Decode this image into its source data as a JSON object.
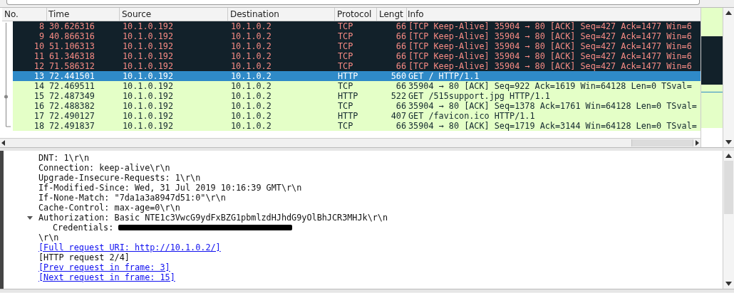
{
  "packet_list": {
    "columns": [
      "No.",
      "Time",
      "Source",
      "Destination",
      "Protocol",
      "Lengt",
      "Info"
    ],
    "rows": [
      {
        "no": "8",
        "time": "30.626316",
        "source": "10.1.0.192",
        "destination": "10.1.0.2",
        "protocol": "TCP",
        "length": "66",
        "info": "[TCP Keep-Alive] 35904 → 80 [ACK] Seq=427 Ack=1477 Win=6",
        "kind": "bad",
        "selected": false
      },
      {
        "no": "9",
        "time": "40.866316",
        "source": "10.1.0.192",
        "destination": "10.1.0.2",
        "protocol": "TCP",
        "length": "66",
        "info": "[TCP Keep-Alive] 35904 → 80 [ACK] Seq=427 Ack=1477 Win=6",
        "kind": "bad",
        "selected": false
      },
      {
        "no": "10",
        "time": "51.106313",
        "source": "10.1.0.192",
        "destination": "10.1.0.2",
        "protocol": "TCP",
        "length": "66",
        "info": "[TCP Keep-Alive] 35904 → 80 [ACK] Seq=427 Ack=1477 Win=6",
        "kind": "bad",
        "selected": false
      },
      {
        "no": "11",
        "time": "61.346318",
        "source": "10.1.0.192",
        "destination": "10.1.0.2",
        "protocol": "TCP",
        "length": "66",
        "info": "[TCP Keep-Alive] 35904 → 80 [ACK] Seq=427 Ack=1477 Win=6",
        "kind": "bad",
        "selected": false
      },
      {
        "no": "12",
        "time": "71.586312",
        "source": "10.1.0.192",
        "destination": "10.1.0.2",
        "protocol": "TCP",
        "length": "66",
        "info": "[TCP Keep-Alive] 35904 → 80 [ACK] Seq=427 Ack=1477 Win=6",
        "kind": "bad",
        "selected": false
      },
      {
        "no": "13",
        "time": "72.441501",
        "source": "10.1.0.192",
        "destination": "10.1.0.2",
        "protocol": "HTTP",
        "length": "560",
        "info": "GET / HTTP/1.1",
        "kind": "good",
        "selected": true
      },
      {
        "no": "14",
        "time": "72.469511",
        "source": "10.1.0.192",
        "destination": "10.1.0.2",
        "protocol": "TCP",
        "length": "66",
        "info": "35904 → 80 [ACK] Seq=922 Ack=1619 Win=64128 Len=0 TSval=",
        "kind": "good",
        "selected": false
      },
      {
        "no": "15",
        "time": "72.487349",
        "source": "10.1.0.192",
        "destination": "10.1.0.2",
        "protocol": "HTTP",
        "length": "522",
        "info": "GET /515support.jpg HTTP/1.1",
        "kind": "good",
        "selected": false
      },
      {
        "no": "16",
        "time": "72.488382",
        "source": "10.1.0.192",
        "destination": "10.1.0.2",
        "protocol": "TCP",
        "length": "66",
        "info": "35904 → 80 [ACK] Seq=1378 Ack=1761 Win=64128 Len=0 TSval=",
        "kind": "good",
        "selected": false
      },
      {
        "no": "17",
        "time": "72.490127",
        "source": "10.1.0.192",
        "destination": "10.1.0.2",
        "protocol": "HTTP",
        "length": "407",
        "info": "GET /favicon.ico HTTP/1.1",
        "kind": "good",
        "selected": false
      },
      {
        "no": "18",
        "time": "72.491837",
        "source": "10.1.0.192",
        "destination": "10.1.0.2",
        "protocol": "TCP",
        "length": "66",
        "info": "35904 → 80 [ACK] Seq=1719 Ack=3144 Win=64128 Len=0 TSval=",
        "kind": "good",
        "selected": false
      }
    ]
  },
  "details": [
    {
      "text": "DNT: 1\\r\\n",
      "kind": "text"
    },
    {
      "text": "Connection: keep-alive\\r\\n",
      "kind": "text"
    },
    {
      "text": "Upgrade-Insecure-Requests: 1\\r\\n",
      "kind": "text"
    },
    {
      "text": "If-Modified-Since: Wed, 31 Jul 2019 10:16:39 GMT\\r\\n",
      "kind": "text"
    },
    {
      "text": "If-None-Match: \"7da1a3a8947d51:0\"\\r\\n",
      "kind": "text"
    },
    {
      "text": "Cache-Control: max-age=0\\r\\n",
      "kind": "text"
    },
    {
      "text": "Authorization: Basic NTE1c3VwcG9ydFxBZG1pbmlzdHJhdG9yOlBhJCR3MHJk\\r\\n",
      "kind": "text",
      "expanded": true,
      "children": [
        {
          "text": "Credentials:",
          "redacted": true
        }
      ]
    },
    {
      "text": "\\r\\n",
      "kind": "text"
    },
    {
      "text": "[Full request URI: http://10.1.0.2/]",
      "kind": "link"
    },
    {
      "text": "[HTTP request 2/4]",
      "kind": "text"
    },
    {
      "text": "[Prev request in frame: 3]",
      "kind": "link"
    },
    {
      "text": "[Next request in frame: 15]",
      "kind": "link"
    }
  ]
}
